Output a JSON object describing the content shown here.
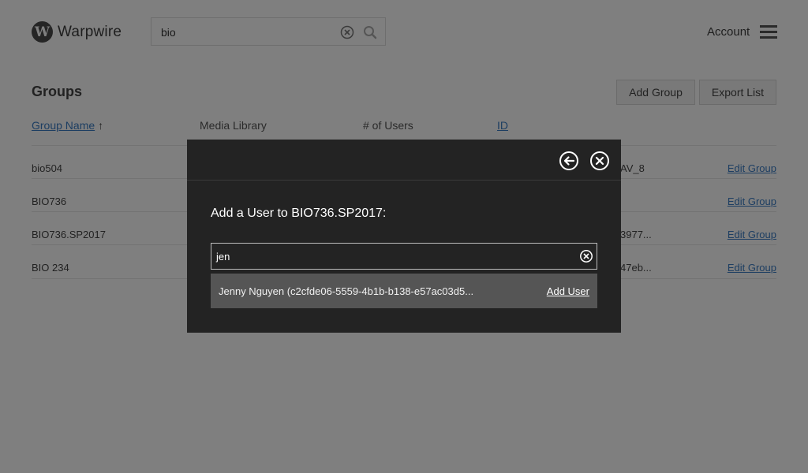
{
  "header": {
    "logo_letter": "W",
    "logo_text": "Warpwire",
    "search_value": "bio",
    "account_label": "Account"
  },
  "groups": {
    "title": "Groups",
    "add_group_label": "Add Group",
    "export_list_label": "Export List",
    "columns": {
      "group_name": "Group Name",
      "sort_indicator": "↑",
      "media_library": "Media Library",
      "num_users": "# of Users",
      "id": "ID"
    },
    "rows": [
      {
        "name": "bio504",
        "id_partial": "AV_8",
        "edit_label": "Edit Group"
      },
      {
        "name": "BIO736",
        "id_partial": "",
        "edit_label": "Edit Group"
      },
      {
        "name": "BIO736.SP2017",
        "id_partial": "3977...",
        "edit_label": "Edit Group"
      },
      {
        "name": "BIO 234",
        "id_partial": "47eb...",
        "edit_label": "Edit Group"
      }
    ]
  },
  "modal": {
    "title": "Add a User to BIO736.SP2017:",
    "search_value": "jen",
    "result": {
      "text": "Jenny Nguyen (c2cfde06-5559-4b1b-b138-e57ac03d5...",
      "action_label": "Add User"
    }
  },
  "colors": {
    "link": "#3b7dc4",
    "modal_bg": "#232323",
    "result_bg": "#555555"
  }
}
